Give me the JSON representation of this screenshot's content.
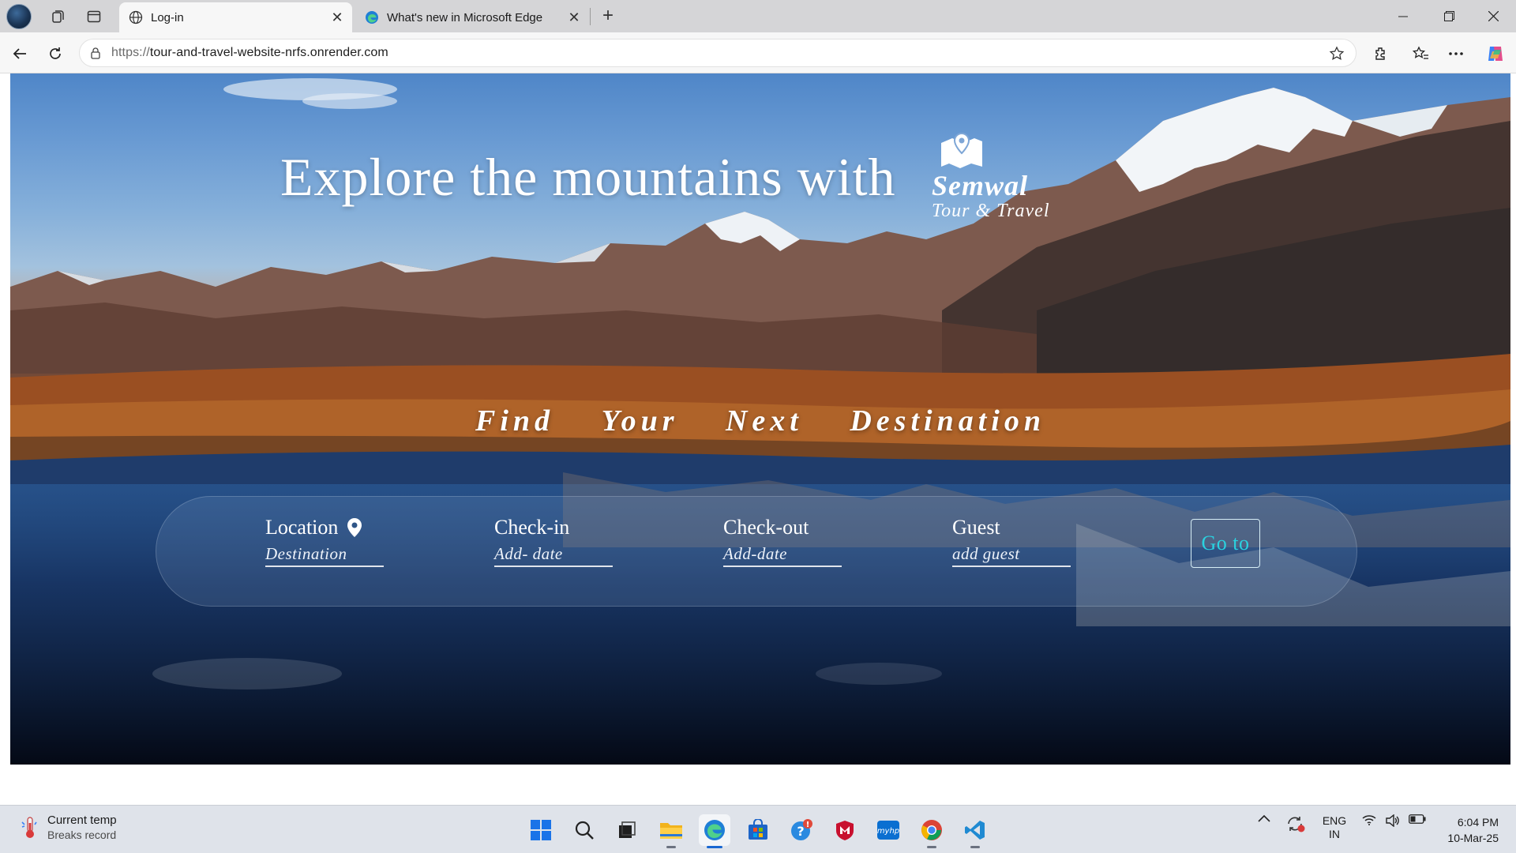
{
  "browser": {
    "tabs": [
      {
        "label": "Log-in",
        "active": true,
        "icon": "globe-icon"
      },
      {
        "label": "What's new in Microsoft Edge",
        "active": false,
        "icon": "edge-icon"
      }
    ],
    "url_scheme": "https://",
    "url_host": "tour-and-travel-website-nrfs.onrender.com"
  },
  "page": {
    "headline": "Explore the mountains with",
    "brand": {
      "name": "Semwal",
      "subtitle": "Tour & Travel",
      "icon": "map-pin-icon"
    },
    "tagline": [
      "Find",
      "Your",
      "Next",
      "Destination"
    ],
    "search": {
      "fields": [
        {
          "label": "Location",
          "placeholder": "Destination",
          "icon": "location-pin-icon"
        },
        {
          "label": "Check-in",
          "placeholder": "Add- date"
        },
        {
          "label": "Check-out",
          "placeholder": "Add-date"
        },
        {
          "label": "Guest",
          "placeholder": "add guest"
        }
      ],
      "button": "Go to"
    }
  },
  "taskbar": {
    "weather": {
      "title": "Current temp",
      "subtitle": "Breaks record"
    },
    "language": {
      "line1": "ENG",
      "line2": "IN"
    },
    "time": "6:04 PM",
    "date": "10-Mar-25",
    "notification_badge": "!"
  },
  "colors": {
    "button_text": "#2ad2e0",
    "accent_taskbar": "#1967d2"
  }
}
